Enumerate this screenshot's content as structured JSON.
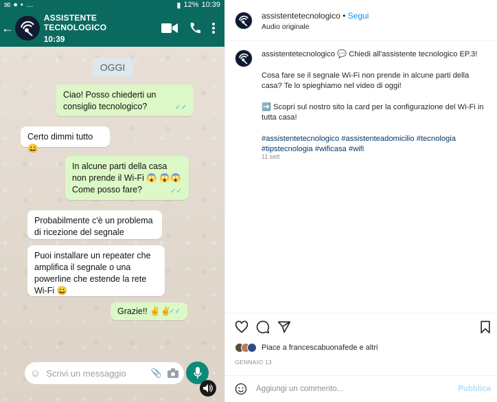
{
  "video": {
    "status_time": "10:39",
    "status_battery": "12%",
    "chat_name": "ASSISTENTE TECNOLOGICO",
    "chat_time": "10:39",
    "day_chip": "OGGI",
    "messages": [
      {
        "dir": "out",
        "text": "Ciao! Posso chiederti un consiglio tecnologico?"
      },
      {
        "dir": "in",
        "text": "Certo dimmi tutto 😀"
      },
      {
        "dir": "out",
        "text": "In alcune parti della casa non prende il Wi-Fi 😱 😱😱 Come posso fare?"
      },
      {
        "dir": "in",
        "text": "Probabilmente c'è un problema di ricezione del segnale"
      },
      {
        "dir": "in",
        "text": "Puoi installare un repeater che amplifica il segnale o una powerline che estende la rete Wi-Fi 😀"
      },
      {
        "dir": "out",
        "text": "Grazie!! ✌️✌️"
      }
    ],
    "composer_placeholder": "Scrivi un messaggio"
  },
  "post": {
    "username": "assistentetecnologico",
    "follow_label": "Segui",
    "audio_label": "Audio originale",
    "caption_head": "💬 Chiedi all'assistente tecnologico EP.3!",
    "caption_p1": "Cosa fare se il segnale Wi-Fi non prende in alcune parti della casa? Te lo spieghiamo nel video di oggi!",
    "caption_p2": "➡️ Scopri sul nostro sito la card per la configurazione del Wi-Fi in tutta casa!",
    "hashtags": "#assistentetecnologico #assistenteadomicilio #tecnologia #tipstecnologia #wificasa #wifi",
    "caption_date": "11 sett",
    "likes_text": "Piace a francescabuonafede e altri",
    "post_date": "GENNAIO 13",
    "comment_placeholder": "Aggiungi un commento...",
    "publish_label": "Pubblica"
  },
  "colors": {
    "whatsapp_green": "#0b6a5f",
    "out_bubble": "#dcf8c6",
    "follow_blue": "#0095f6",
    "hashtag": "#00376b"
  }
}
